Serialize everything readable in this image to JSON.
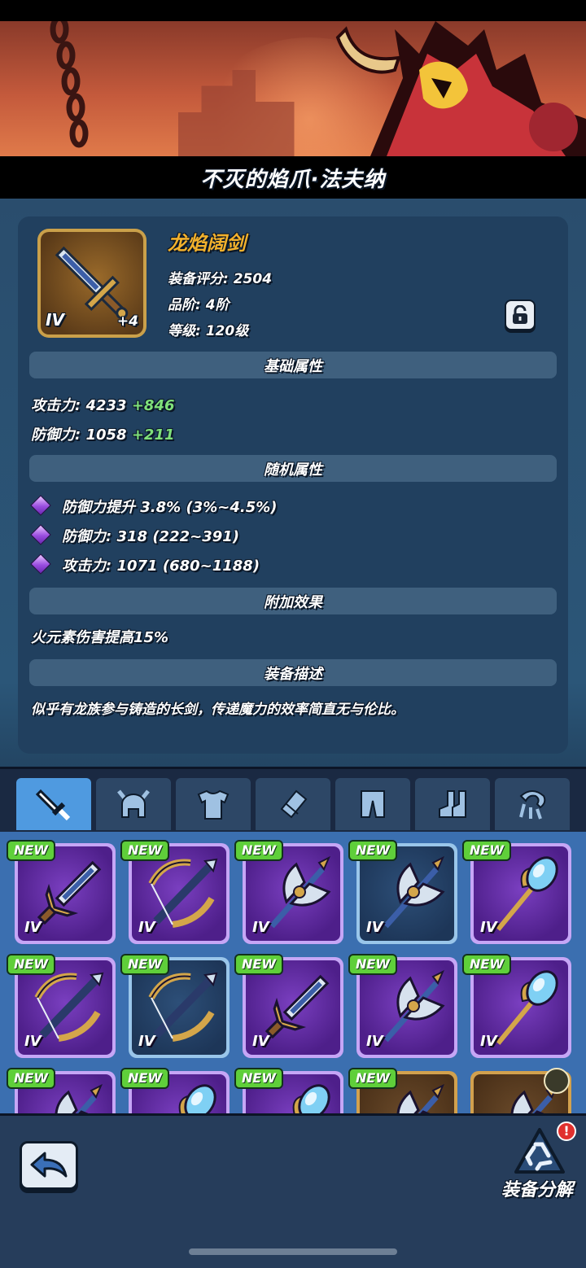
{
  "hero": {
    "name": "不灭的焰爪·法夫纳"
  },
  "item": {
    "name": "龙焰阔剑",
    "tier": "IV",
    "enhance": "+4",
    "score": "装备评分: 2504",
    "quality": "品阶: 4阶",
    "level": "等级: 120级",
    "locked": false
  },
  "sections": {
    "base": "基础属性",
    "random": "随机属性",
    "extra": "附加效果",
    "desc": "装备描述"
  },
  "base_stats": [
    {
      "label": "攻击力: 4233",
      "bonus": "+846"
    },
    {
      "label": "防御力: 1058",
      "bonus": "+211"
    }
  ],
  "random_stats": [
    {
      "label": "防御力提升 3.8%",
      "range": "(3%~4.5%)"
    },
    {
      "label": "防御力: 318",
      "range": "(222~391)"
    },
    {
      "label": "攻击力: 1071",
      "range": "(680~1188)"
    }
  ],
  "extra_effect": "火元素伤害提高15%",
  "description": "似乎有龙族参与铸造的长剑，传递魔力的效率简直无与伦比。",
  "tabs": [
    {
      "name": "weapon",
      "icon": "sword-icon",
      "active": true
    },
    {
      "name": "helmet",
      "icon": "helmet-icon",
      "active": false
    },
    {
      "name": "armor",
      "icon": "armor-icon",
      "active": false
    },
    {
      "name": "gloves",
      "icon": "gloves-icon",
      "active": false
    },
    {
      "name": "pants",
      "icon": "pants-icon",
      "active": false
    },
    {
      "name": "boots",
      "icon": "boots-icon",
      "active": false
    },
    {
      "name": "accessory",
      "icon": "accessory-icon",
      "active": false
    }
  ],
  "inventory": {
    "new_label": "NEW",
    "tier_label": "IV",
    "rows": [
      [
        {
          "weapon": "sword",
          "rarity": "purple",
          "new": true
        },
        {
          "weapon": "crossbow",
          "rarity": "purple",
          "new": true
        },
        {
          "weapon": "axe",
          "rarity": "purple",
          "new": true
        },
        {
          "weapon": "axe",
          "rarity": "blue",
          "new": true
        },
        {
          "weapon": "staff",
          "rarity": "purple",
          "new": true
        }
      ],
      [
        {
          "weapon": "crossbow",
          "rarity": "purple",
          "new": true
        },
        {
          "weapon": "crossbow",
          "rarity": "blue",
          "new": true
        },
        {
          "weapon": "sword",
          "rarity": "purple",
          "new": true
        },
        {
          "weapon": "axe",
          "rarity": "purple",
          "new": true
        },
        {
          "weapon": "staff",
          "rarity": "purple",
          "new": true
        }
      ],
      [
        {
          "weapon": "axe",
          "rarity": "purple",
          "new": true
        },
        {
          "weapon": "staff",
          "rarity": "purple",
          "new": true
        },
        {
          "weapon": "staff",
          "rarity": "purple",
          "new": true
        },
        {
          "weapon": "axe",
          "rarity": "gold",
          "new": true
        },
        {
          "weapon": "axe",
          "rarity": "gold",
          "new": false,
          "equipped_badge": true
        }
      ]
    ]
  },
  "bottom": {
    "salvage_label": "装备分解",
    "alert": "!"
  },
  "colors": {
    "item_name": "#f2b12c",
    "bonus": "#7fe07a",
    "tab_active": "#4f9ae0",
    "new_badge": "#5fcf3a",
    "alert": "#e0302e"
  }
}
